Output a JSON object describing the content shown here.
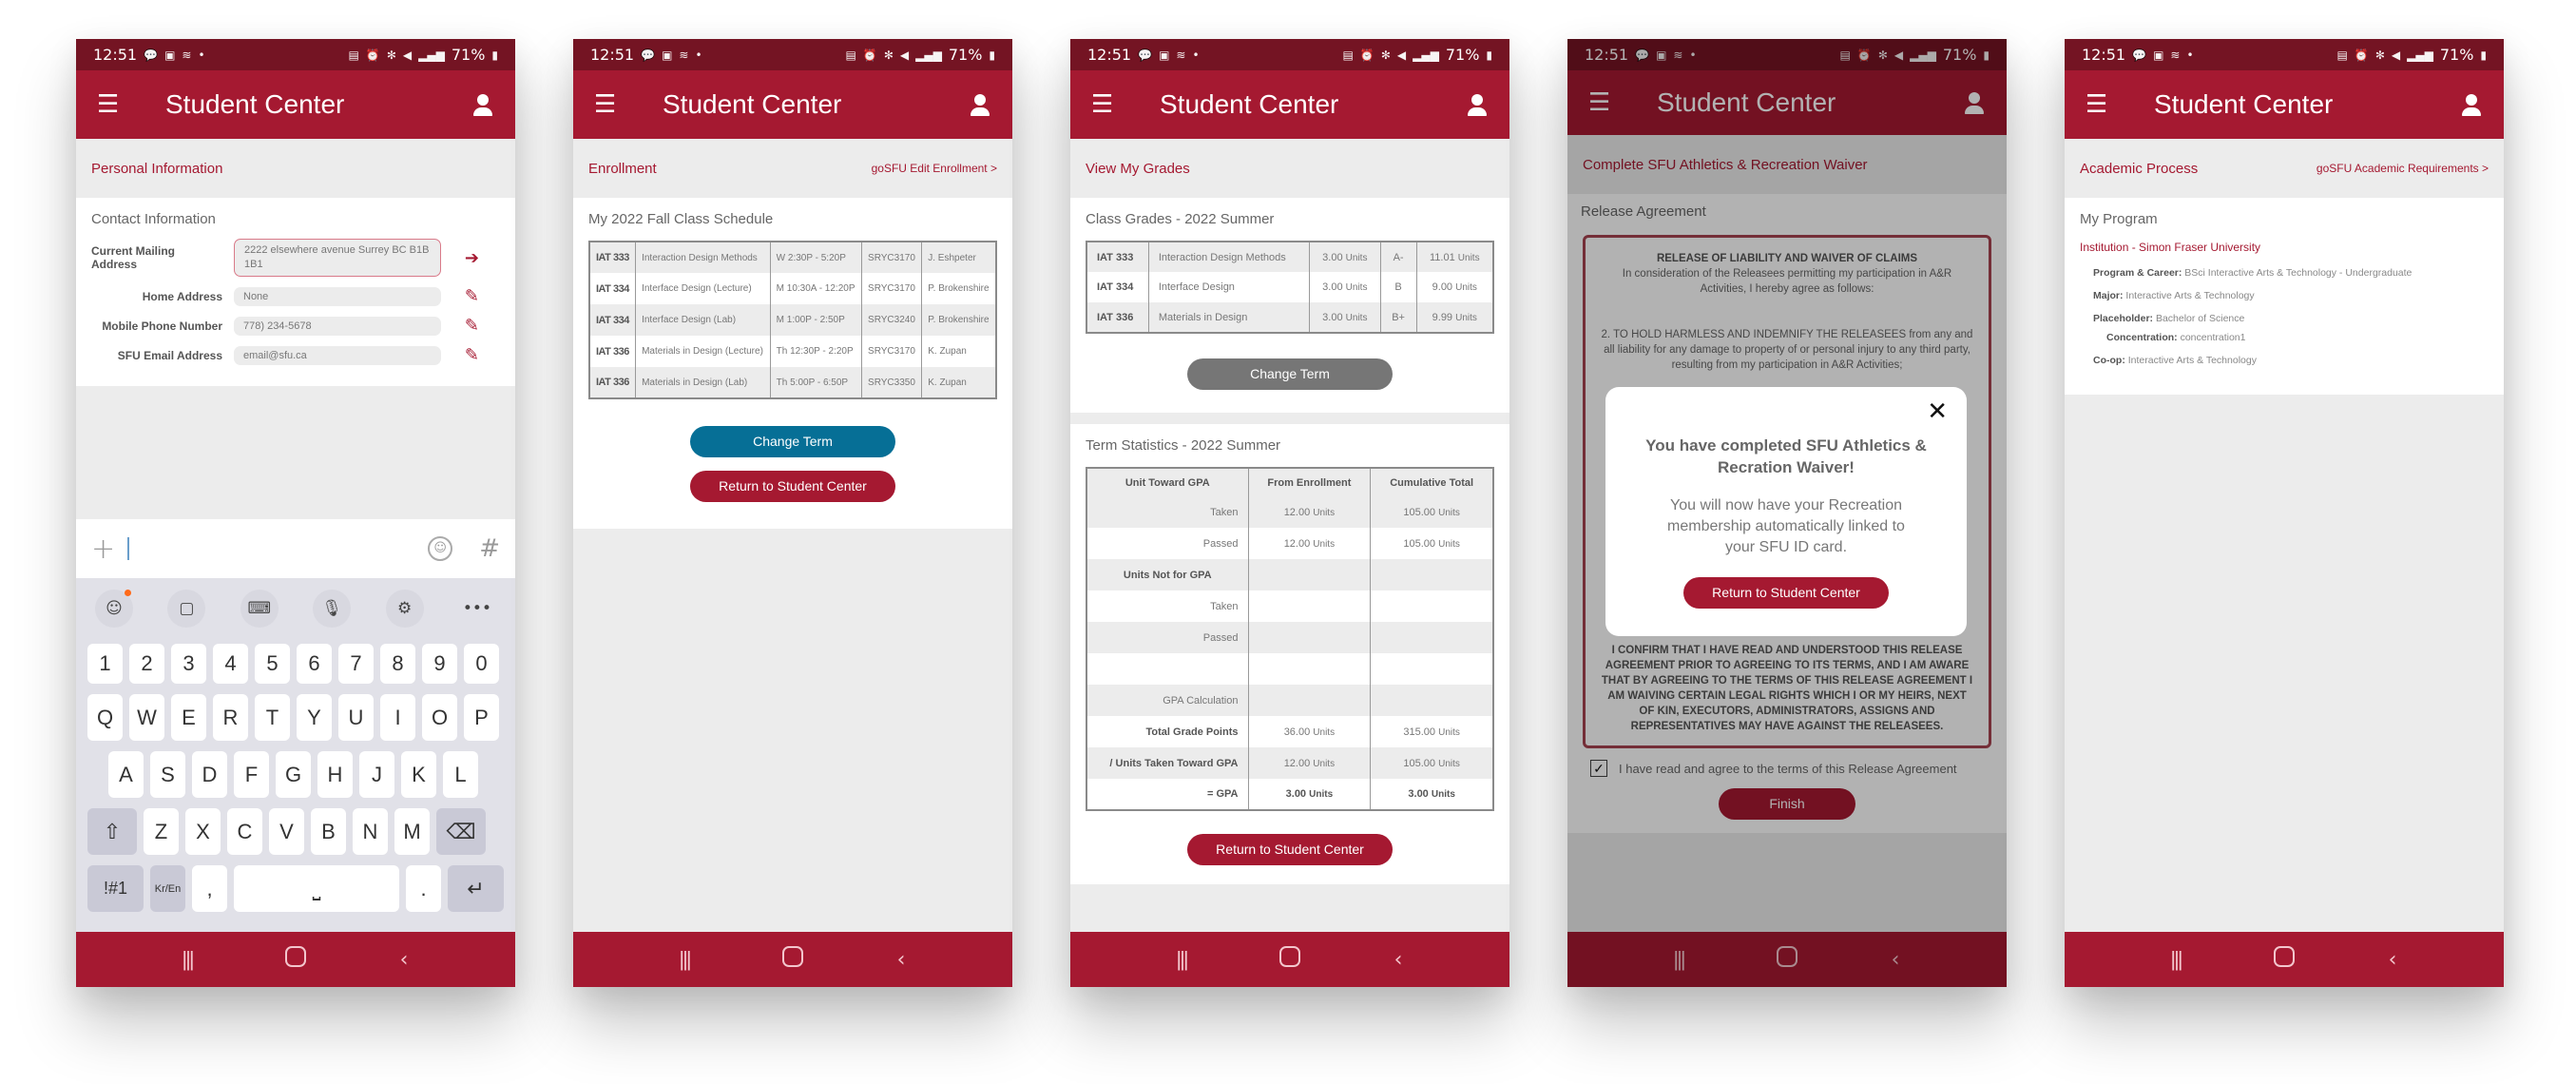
{
  "status_bar": {
    "time": "12:51",
    "battery": "71%",
    "left_icons": [
      "chat-icon",
      "image-icon",
      "wifi-icon",
      "dot-icon"
    ],
    "right_icons": [
      "sync-icon",
      "alarm-icon",
      "bluetooth-icon",
      "mute-icon",
      "lte-icon",
      "signal-icon",
      "battery-icon"
    ]
  },
  "app": {
    "title": "Student Center"
  },
  "colors": {
    "brand_red": "#a51931",
    "status_dark": "#741423",
    "blue": "#066f96",
    "grey_button": "#767676"
  },
  "screens": {
    "personal": {
      "section_title": "Personal Information",
      "card_title": "Contact Information",
      "rows": [
        {
          "label": "Current Mailing Address",
          "value": "2222 elsewhere avenue Surrey BC B1B 1B1",
          "action": "arrow-right-icon"
        },
        {
          "label": "Home Address",
          "value": "None",
          "action": "pencil-icon"
        },
        {
          "label": "Mobile Phone Number",
          "value": "778) 234-5678",
          "action": "pencil-icon"
        },
        {
          "label": "SFU Email Address",
          "value": "email@sfu.ca",
          "action": "pencil-icon"
        }
      ],
      "keyboard": {
        "numbers": [
          "1",
          "2",
          "3",
          "4",
          "5",
          "6",
          "7",
          "8",
          "9",
          "0"
        ],
        "row1": [
          "Q",
          "W",
          "E",
          "R",
          "T",
          "Y",
          "U",
          "I",
          "O",
          "P"
        ],
        "row2": [
          "A",
          "S",
          "D",
          "F",
          "G",
          "H",
          "J",
          "K",
          "L"
        ],
        "row3": [
          "Z",
          "X",
          "C",
          "V",
          "B",
          "N",
          "M"
        ],
        "symbols_key": "!#1",
        "lang_key": "Kr/En",
        "comma": ",",
        "period": "."
      }
    },
    "enrollment": {
      "section_title": "Enrollment",
      "section_link": "goSFU Edit Enrollment  >",
      "card_title": "My 2022 Fall Class Schedule",
      "schedule": [
        {
          "code": "IAT 333",
          "name": "Interaction Design Methods",
          "time": "W 2:30P - 5:20P",
          "room": "SRYC3170",
          "instructor": "J. Eshpeter"
        },
        {
          "code": "IAT 334",
          "name": "Interface Design (Lecture)",
          "time": "M 10:30A - 12:20P",
          "room": "SRYC3170",
          "instructor": "P. Brokenshire"
        },
        {
          "code": "IAT 334",
          "name": "Interface Design (Lab)",
          "time": "M 1:00P - 2:50P",
          "room": "SRYC3240",
          "instructor": "P. Brokenshire"
        },
        {
          "code": "IAT 336",
          "name": "Materials in Design (Lecture)",
          "time": "Th 12:30P - 2:20P",
          "room": "SRYC3170",
          "instructor": "K. Zupan"
        },
        {
          "code": "IAT 336",
          "name": "Materials in Design (Lab)",
          "time": "Th 5:00P - 6:50P",
          "room": "SRYC3350",
          "instructor": "K. Zupan"
        }
      ],
      "change_term": "Change Term",
      "return": "Return to Student Center"
    },
    "grades": {
      "section_title": "View My Grades",
      "card_title": "Class Grades - 2022 Summer",
      "grades": [
        {
          "code": "IAT 333",
          "name": "Interaction Design Methods",
          "units": "3.00",
          "grade": "A-",
          "points": "11.01"
        },
        {
          "code": "IAT 334",
          "name": "Interface Design",
          "units": "3.00",
          "grade": "B",
          "points": "9.00"
        },
        {
          "code": "IAT 336",
          "name": "Materials in Design",
          "units": "3.00",
          "grade": "B+",
          "points": "9.99"
        }
      ],
      "unit_suffix": "Units",
      "change_term": "Change Term",
      "stats_title": "Term Statistics - 2022 Summer",
      "stats_headers": [
        "Unit Toward GPA",
        "From Enrollment",
        "Cumulative Total"
      ],
      "stats_rows": [
        {
          "label": "Taken",
          "from": "12.00",
          "cum": "105.00"
        },
        {
          "label": "Passed",
          "from": "12.00",
          "cum": "105.00"
        },
        {
          "label": "Units Not for GPA",
          "from": "",
          "cum": ""
        },
        {
          "label": "Taken",
          "from": "",
          "cum": ""
        },
        {
          "label": "Passed",
          "from": "",
          "cum": ""
        },
        {
          "label": "",
          "from": "",
          "cum": ""
        },
        {
          "label": "GPA Calculation",
          "from": "",
          "cum": ""
        },
        {
          "label": "Total Grade Points",
          "from": "36.00",
          "cum": "315.00"
        },
        {
          "label": "/ Units Taken Toward GPA",
          "from": "12.00",
          "cum": "105.00"
        },
        {
          "label": "= GPA",
          "from": "3.00",
          "cum": "3.00"
        }
      ],
      "return": "Return to Student Center"
    },
    "waiver": {
      "section_title": "Complete SFU Athletics & Recreation Waiver",
      "card_title": "Release Agreement",
      "heading": "RELEASE OF LIABILITY AND WAIVER OF CLAIMS",
      "intro": "In consideration of the Releasees permitting my participation in A&R Activities, I hereby agree as follows:",
      "clause2": "2. TO HOLD HARMLESS AND INDEMNIFY THE RELEASEES from any and all liability for any damage to property of or personal injury to any third party, resulting from my participation in A&R Activities;",
      "confirm": "I CONFIRM THAT I HAVE READ AND UNDERSTOOD THIS RELEASE AGREEMENT PRIOR TO AGREEING TO ITS TERMS, AND I AM AWARE THAT BY AGREEING TO THE TERMS OF THIS RELEASE AGREEMENT I AM WAIVING CERTAIN LEGAL RIGHTS WHICH I OR MY HEIRS, NEXT OF KIN, EXECUTORS, ADMINISTRATORS, ASSIGNS AND REPRESENTATIVES MAY HAVE AGAINST THE RELEASEES.",
      "agree_label": "I have read and agree to the terms of this Release Agreement",
      "agree_checked": true,
      "finish": "Finish",
      "modal": {
        "title": "You have completed SFU Athletics & Recration Waiver!",
        "body": "You will now have your Recreation membership automatically linked to your SFU ID card.",
        "button": "Return to Student Center"
      }
    },
    "academic": {
      "section_title": "Academic Process",
      "section_link": "goSFU Academic Requirements  >",
      "card_title": "My Program",
      "institution": "Institution - Simon Fraser University",
      "rows": [
        {
          "label": "Program & Career:",
          "value": "BSci Interactive Arts & Technology - Undergraduate"
        },
        {
          "label": "Major:",
          "value": "Interactive Arts & Technology"
        },
        {
          "label": "Placeholder:",
          "value": "Bachelor of Science"
        },
        {
          "label": "Concentration:",
          "value": "concentration1"
        },
        {
          "label": "Co-op:",
          "value": "Interactive Arts & Technology"
        }
      ]
    }
  }
}
